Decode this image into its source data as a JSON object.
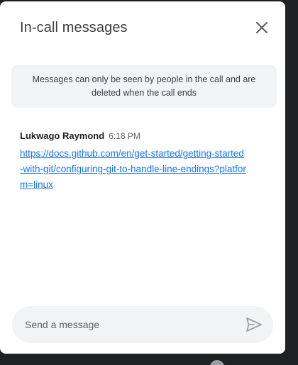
{
  "panel": {
    "title": "In-call messages",
    "close_icon": "close-icon"
  },
  "notice": {
    "text": "Messages can only be seen by people in the call and are deleted when the call ends"
  },
  "messages": [
    {
      "sender": "Lukwago Raymond",
      "time": "6:18 PM",
      "link_text": "https://docs.github.com/en/get-started/getting-started-with-git/configuring-git-to-handle-line-endings?platform=linux"
    }
  ],
  "composer": {
    "placeholder": "Send a message",
    "value": "",
    "send_icon": "send-icon"
  },
  "colors": {
    "background": "#202124",
    "panel": "#ffffff",
    "notice_bg": "#f1f3f4",
    "link": "#1a73e8",
    "send_icon": "#9aa0a6"
  }
}
